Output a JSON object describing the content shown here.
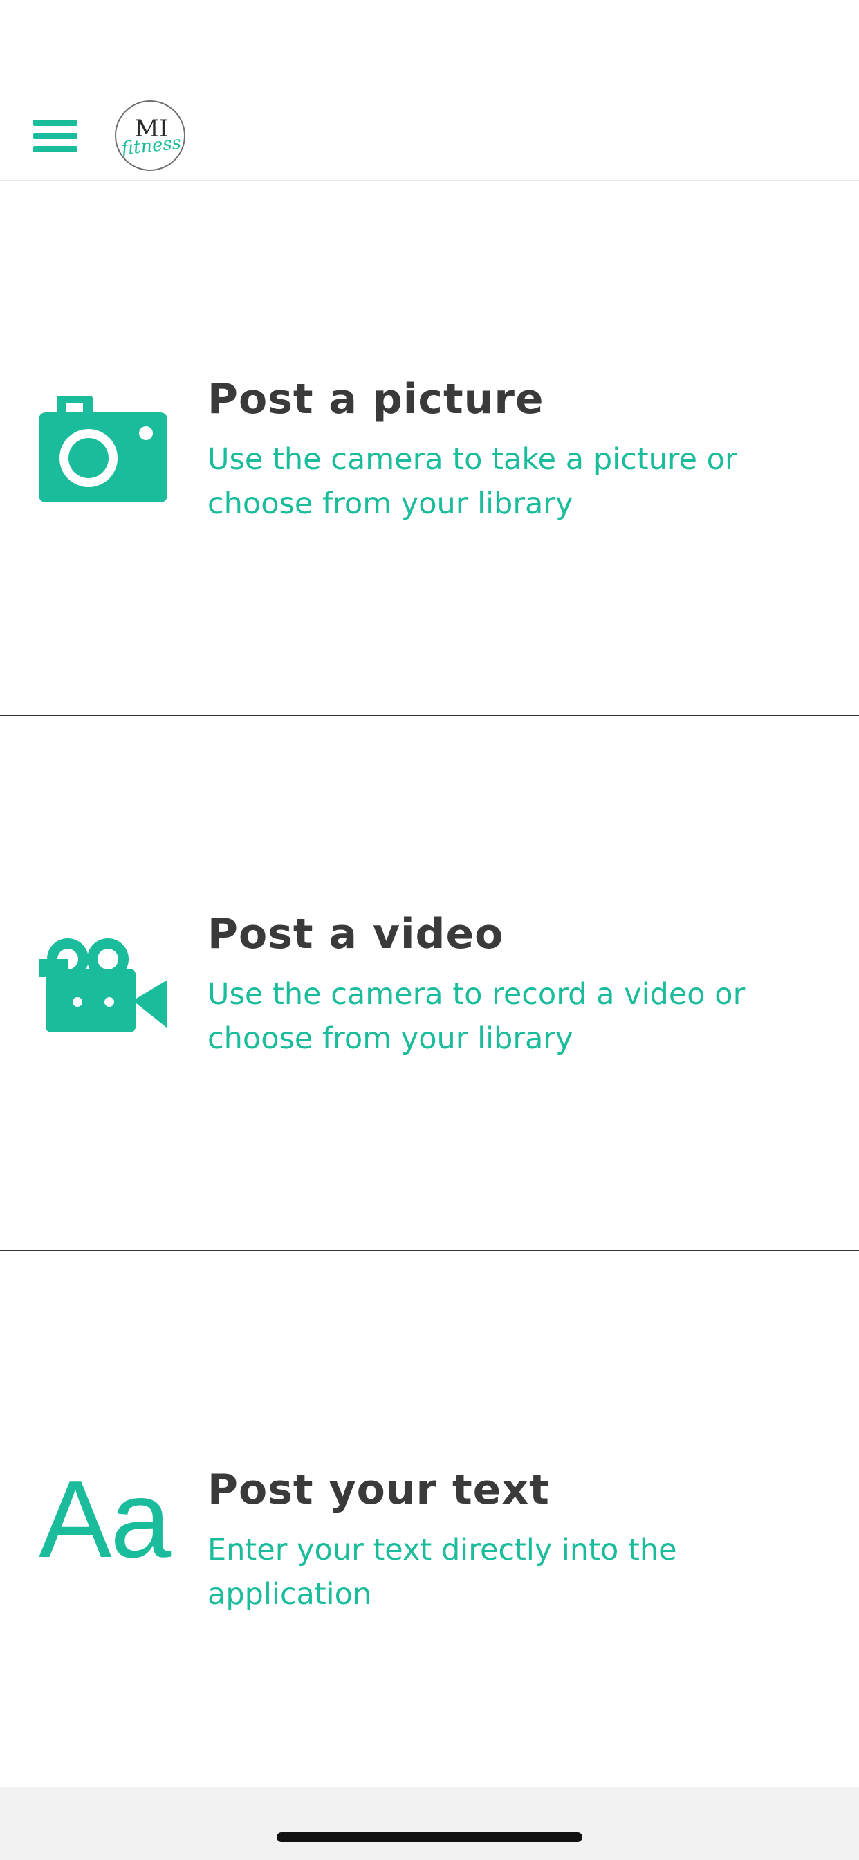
{
  "theme": {
    "accent": "#1bbc9b",
    "title_color": "#3a3a3a",
    "divider": "#333333"
  },
  "header": {
    "menu_icon": "hamburger-menu-icon",
    "logo_text_top": "MI",
    "logo_text_bottom": "fitness"
  },
  "options": [
    {
      "icon": "camera-icon",
      "title": "Post a picture",
      "description": "Use the camera to take a picture or choose from your library"
    },
    {
      "icon": "video-camera-icon",
      "title": "Post a video",
      "description": "Use the camera to record a video or choose from your library"
    },
    {
      "icon": "text-icon",
      "icon_glyph": "Aa",
      "title": "Post your text",
      "description": "Enter your text directly into the application"
    }
  ]
}
